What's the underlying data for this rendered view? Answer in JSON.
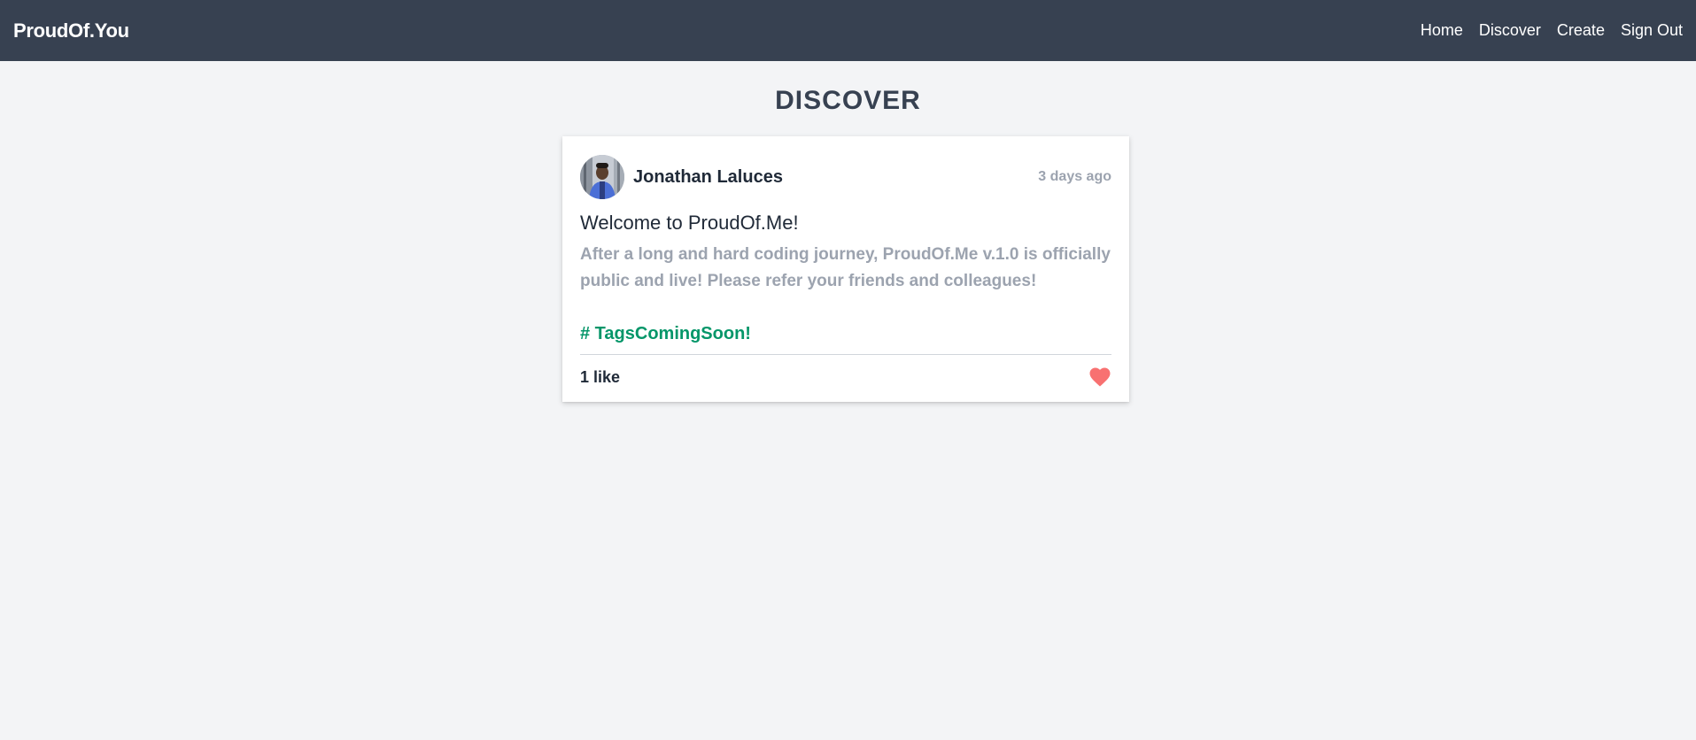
{
  "navbar": {
    "brand": "ProudOf.You",
    "links": [
      {
        "label": "Home"
      },
      {
        "label": "Discover"
      },
      {
        "label": "Create"
      },
      {
        "label": "Sign Out"
      }
    ],
    "background": "#374151"
  },
  "page": {
    "title": "DISCOVER"
  },
  "post": {
    "author": "Jonathan Laluces",
    "timestamp": "3 days ago",
    "title": "Welcome to ProudOf.Me!",
    "body": "After a long and hard coding journey, ProudOf.Me v.1.0 is officially public and live! Please refer your friends and colleagues!",
    "tag": "# TagsComingSoon!",
    "likes": "1 like",
    "like_icon": "heart-icon",
    "like_color": "#f87171",
    "tag_color": "#059669"
  }
}
